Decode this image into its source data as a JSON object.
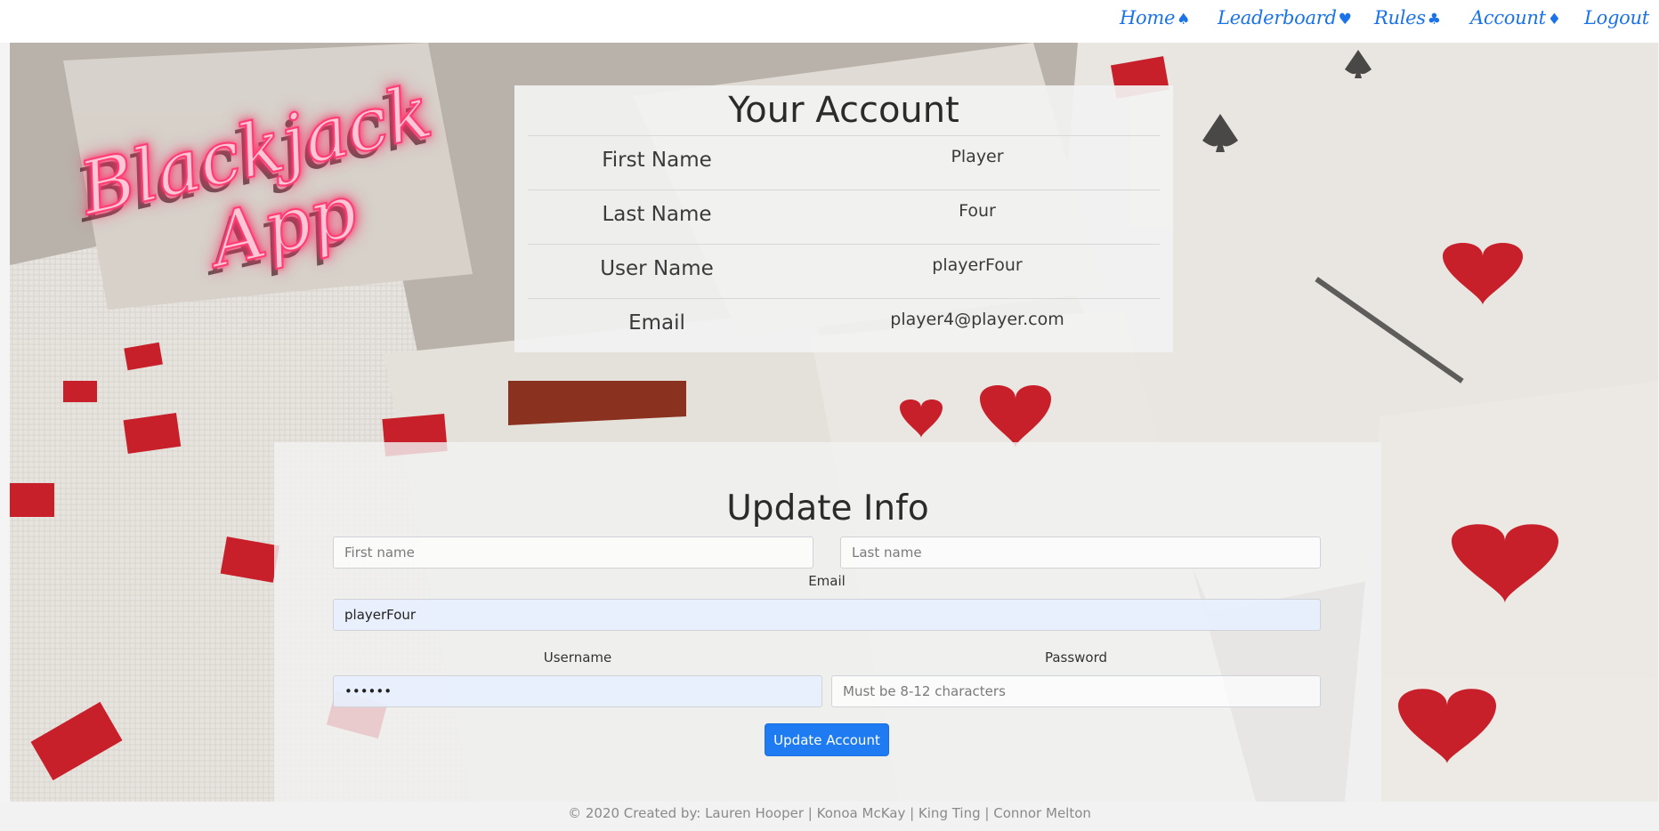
{
  "nav": {
    "items": [
      {
        "label": "Home",
        "suit": "♠"
      },
      {
        "label": "Leaderboard",
        "suit": "♥"
      },
      {
        "label": "Rules",
        "suit": "♣"
      },
      {
        "label": "Account",
        "suit": "♦"
      },
      {
        "label": "Logout",
        "suit": ""
      }
    ]
  },
  "logo": {
    "line1": "Blackjack",
    "line2": "App"
  },
  "account": {
    "title": "Your Account",
    "rows": [
      {
        "label": "First Name",
        "value": "Player"
      },
      {
        "label": "Last Name",
        "value": "Four"
      },
      {
        "label": "User Name",
        "value": "playerFour"
      },
      {
        "label": "Email",
        "value": "player4@player.com"
      }
    ]
  },
  "update": {
    "title": "Update Info",
    "first_name_placeholder": "First name",
    "last_name_placeholder": "Last name",
    "email_label": "Email",
    "email_value": "playerFour",
    "username_label": "Username",
    "username_value": "••••••",
    "password_label": "Password",
    "password_placeholder": "Must be 8-12 characters",
    "button_label": "Update Account"
  },
  "footer": {
    "text": "© 2020 Created by: Lauren Hooper | Konoa McKay | King Ting | Connor Melton"
  },
  "colors": {
    "accent": "#1e7bf2",
    "nav_link": "#1a73e8",
    "neon": "#ff3c74"
  }
}
